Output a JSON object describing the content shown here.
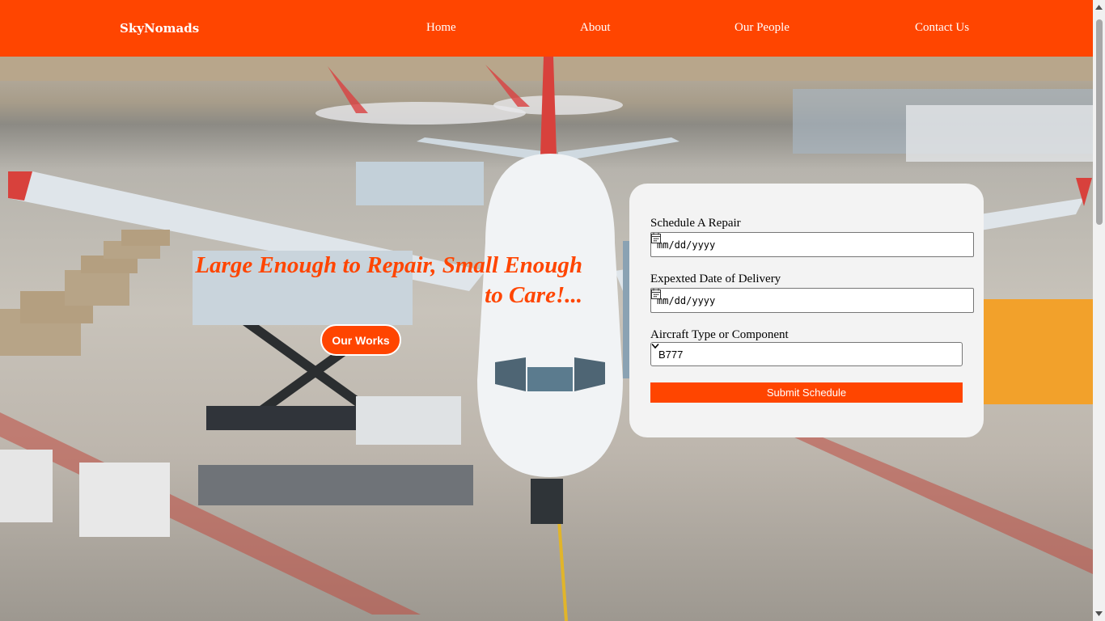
{
  "header": {
    "brand": "SkyNomads",
    "nav": [
      "Home",
      "About",
      "Our People",
      "Contact Us"
    ]
  },
  "hero": {
    "heading_line1": "Large Enough to Repair, Small Enough",
    "heading_line2": "to Care!...",
    "cta_label": "Our Works"
  },
  "form": {
    "repair_label": "Schedule A Repair",
    "repair_value": "mm/dd/yyyy",
    "delivery_label": "Expexted Date of Delivery",
    "delivery_value": "mm/dd/yyyy",
    "aircraft_label": "Aircraft Type or Component",
    "aircraft_selected": "B777",
    "submit_label": "Submit Schedule"
  },
  "colors": {
    "accent": "#ff4500",
    "card": "#f3f3f3"
  },
  "icons": [
    "calendar-icon",
    "chevron-down-icon",
    "scroll-up-icon",
    "scroll-down-icon"
  ]
}
